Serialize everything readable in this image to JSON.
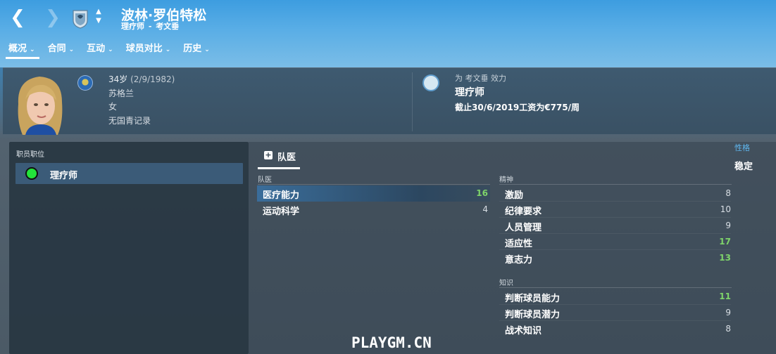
{
  "header": {
    "name": "波林·罗伯特松",
    "role": "理疗师",
    "separator": "-",
    "club": "考文垂",
    "back_icon": "chevron-left-icon",
    "forward_icon": "chevron-right-icon"
  },
  "tabs": [
    {
      "label": "概况",
      "active": true
    },
    {
      "label": "合同",
      "active": false
    },
    {
      "label": "互动",
      "active": false
    },
    {
      "label": "球员对比",
      "active": false
    },
    {
      "label": "历史",
      "active": false
    }
  ],
  "bio": {
    "age": "34岁",
    "dob": "(2/9/1982)",
    "nationality": "苏格兰",
    "gender": "女",
    "youth_record": "无国青记录"
  },
  "contract": {
    "plays_for": "为 考文垂 效力",
    "role": "理疗师",
    "wage_text": "截止30/6/2019工资为€775/周"
  },
  "positions": {
    "title": "职员职位",
    "items": [
      {
        "label": "理疗师",
        "color": "#23e33b"
      }
    ]
  },
  "section_tab": "队医",
  "personality": {
    "label": "性格",
    "value": "稳定"
  },
  "groups": {
    "medical": {
      "label": "队医",
      "attributes": [
        {
          "name": "医疗能力",
          "value": "16"
        },
        {
          "name": "运动科学",
          "value": "4"
        }
      ]
    },
    "mental": {
      "label": "精神",
      "attributes": [
        {
          "name": "激励",
          "value": "8"
        },
        {
          "name": "纪律要求",
          "value": "10"
        },
        {
          "name": "人员管理",
          "value": "9"
        },
        {
          "name": "适应性",
          "value": "17"
        },
        {
          "name": "意志力",
          "value": "13"
        }
      ]
    },
    "knowledge": {
      "label": "知识",
      "attributes": [
        {
          "name": "判断球员能力",
          "value": "11"
        },
        {
          "name": "判断球员潜力",
          "value": "9"
        },
        {
          "name": "战术知识",
          "value": "8"
        }
      ]
    }
  },
  "watermark": "PLAYGM.CN",
  "colors": {
    "accent": "#3d9de0",
    "good_value": "#7ed36a",
    "position_dot": "#23e33b"
  }
}
